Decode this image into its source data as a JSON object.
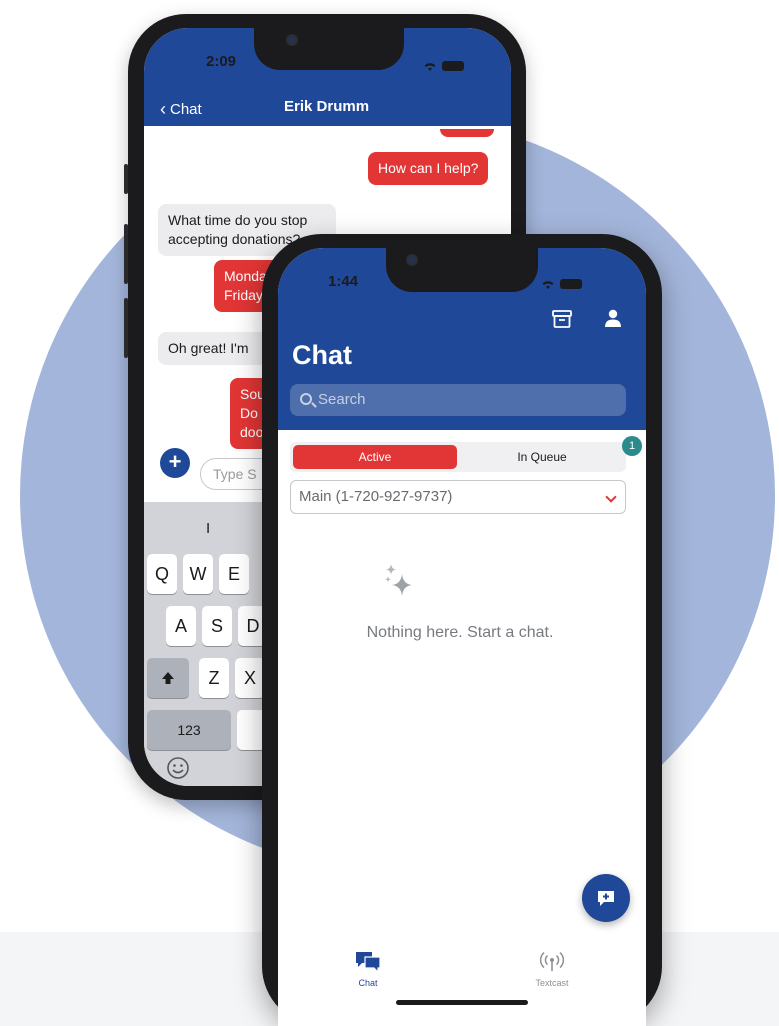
{
  "colors": {
    "brand_blue": "#1f4898",
    "accent_red": "#e23535",
    "badge_teal": "#2a8a8c",
    "backdrop": "#a3b5da"
  },
  "back_phone": {
    "status_time": "2:09",
    "nav": {
      "back_label": "Chat",
      "title": "Erik Drumm"
    },
    "messages": [
      {
        "dir": "out",
        "text": "How can I help?"
      },
      {
        "dir": "in",
        "text": "What time do you stop accepting donations?"
      },
      {
        "dir": "out",
        "text": "Monda\nFriday"
      },
      {
        "dir": "in",
        "text": "Oh great! I'm"
      },
      {
        "dir": "out",
        "text": "Sou\nDo\ndoo"
      }
    ],
    "compose": {
      "placeholder": "Type S"
    },
    "keyboard": {
      "suggestion": "I",
      "row1": [
        "Q",
        "W",
        "E"
      ],
      "row2": [
        "A",
        "S",
        "D"
      ],
      "row3": [
        "Z",
        "X"
      ],
      "numbers_key": "123"
    }
  },
  "front_phone": {
    "status_time": "1:44",
    "title": "Chat",
    "search_placeholder": "Search",
    "segments": {
      "active": "Active",
      "queue": "In Queue",
      "queue_badge": "1"
    },
    "line_select": "Main (1-720-927-9737)",
    "empty_state": "Nothing here. Start a chat.",
    "tabs": [
      {
        "label": "Chat",
        "icon": "chat-bubbles-icon",
        "selected": true
      },
      {
        "label": "Textcast",
        "icon": "broadcast-icon",
        "selected": false
      }
    ]
  }
}
